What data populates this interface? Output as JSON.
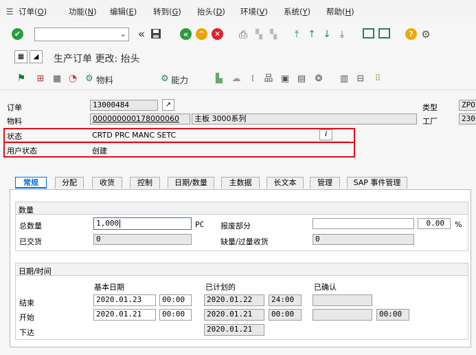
{
  "menu": {
    "items": [
      {
        "text": "订单(",
        "key": "O",
        "end": ")"
      },
      {
        "text": "功能(",
        "key": "N",
        "end": ")"
      },
      {
        "text": "编辑(",
        "key": "E",
        "end": ")"
      },
      {
        "text": "转到(",
        "key": "G",
        "end": ")"
      },
      {
        "text": "抬头(",
        "key": "D",
        "end": ")"
      },
      {
        "text": "环境(",
        "key": "V",
        "end": ")"
      },
      {
        "text": "系统(",
        "key": "Y",
        "end": ")"
      },
      {
        "text": "帮助(",
        "key": "H",
        "end": ")"
      }
    ]
  },
  "toolbar1": {
    "command_value": "",
    "icons": [
      "check-icon",
      "double-left-icon",
      "save-icon",
      "back-icon",
      "exit-icon",
      "cancel-icon",
      "print-icon",
      "find-icon",
      "find-next-icon",
      "first-page-icon",
      "prev-page-icon",
      "next-page-icon",
      "last-page-icon",
      "new-session-icon",
      "shortcut-icon",
      "help-icon",
      "settings-icon"
    ]
  },
  "title": "生产订单 更改: 抬头",
  "toolbar2": {
    "material_label": "物料",
    "capacity_label": "能力"
  },
  "header": {
    "order_label": "订单",
    "order_value": "13000484",
    "material_label": "物料",
    "material_value": "000000000178000060",
    "material_desc": "主板 3000系列",
    "type_label": "类型",
    "type_value": "ZPO",
    "plant_label": "工厂",
    "plant_value": "230",
    "status_label": "状态",
    "status_value": "CRTD PRC  MANC SETC",
    "user_status_label": "用户状态",
    "user_status_value": "创建"
  },
  "tabs": [
    {
      "label": "常规",
      "active": true
    },
    {
      "label": "分配",
      "active": false
    },
    {
      "label": "收货",
      "active": false
    },
    {
      "label": "控制",
      "active": false
    },
    {
      "label": "日期/数量",
      "active": false
    },
    {
      "label": "主数据",
      "active": false
    },
    {
      "label": "长文本",
      "active": false
    },
    {
      "label": "管理",
      "active": false
    },
    {
      "label": "SAP 事件管理",
      "active": false
    }
  ],
  "quantity": {
    "group_title": "数量",
    "total_label": "总数量",
    "total_value": "1,000",
    "unit": "PC",
    "scrap_label": "报废部分",
    "scrap_value": "",
    "scrap_pct": "0.00",
    "pct_sign": "%",
    "delivered_label": "已交货",
    "delivered_value": "0",
    "shortage_label": "缺量/过量收货",
    "shortage_value": "0"
  },
  "dates": {
    "group_title": "日期/时间",
    "col_basic": "基本日期",
    "col_scheduled": "已计划的",
    "col_confirmed": "已确认",
    "end_label": "结束",
    "end_basic_date": "2020.01.23",
    "end_basic_time": "00:00",
    "end_sched_date": "2020.01.22",
    "end_sched_time": "24:00",
    "start_label": "开始",
    "start_basic_date": "2020.01.21",
    "start_basic_time": "00:00",
    "start_sched_date": "2020.01.21",
    "start_sched_time": "00:00",
    "start_conf_time": "00:00",
    "release_label": "下达",
    "release_sched_date": "2020.01.21"
  }
}
